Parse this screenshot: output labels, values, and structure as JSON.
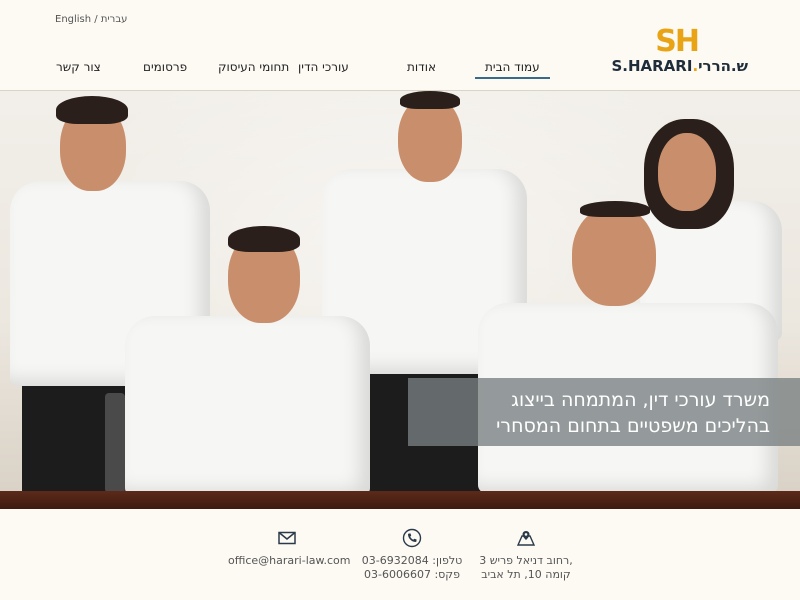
{
  "header": {
    "lang_english": "English",
    "lang_separator": "/",
    "lang_hebrew": "עברית",
    "logo_mark": "SH",
    "logo_name_en": "S.HARARI",
    "logo_name_he": "ש.הררי",
    "nav": [
      {
        "label": "עמוד הבית",
        "active": true
      },
      {
        "label": "אודות",
        "active": false
      },
      {
        "label": "עורכי הדין",
        "active": false
      },
      {
        "label": "תחומי העיסוק",
        "active": false
      },
      {
        "label": "פרסומים",
        "active": false
      },
      {
        "label": "צור קשר",
        "active": false
      }
    ]
  },
  "hero": {
    "tagline_line1": "משרד עורכי דין, המתמחה בייצוג",
    "tagline_line2": "בהליכים משפטיים בתחום המסחרי"
  },
  "footer": {
    "address_line1": "רחוב דניאל פריש 3,",
    "address_line2": "קומה 10, תל אביב",
    "phone_line1": "טלפון: 03-6932084",
    "phone_line2": "פקס: 03-6006607",
    "email": "office@harari-law.com"
  },
  "colors": {
    "accent": "#e9a415",
    "navy": "#1f2c3a",
    "nav_underline": "#3a6a8a"
  },
  "icons": {
    "address": "map-icon",
    "phone": "phone-icon",
    "email": "envelope-icon"
  }
}
